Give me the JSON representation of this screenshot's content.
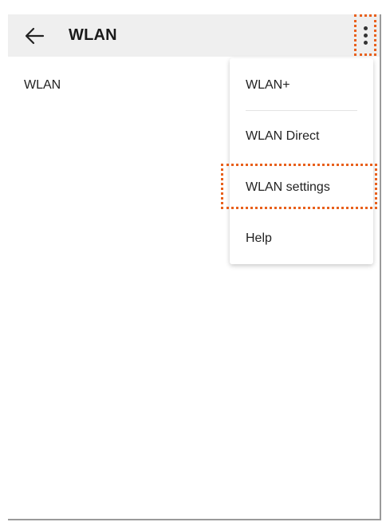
{
  "appbar": {
    "back_icon": "arrow-left-icon",
    "title": "WLAN",
    "overflow_icon": "more-vertical-icon"
  },
  "content": {
    "label": "WLAN"
  },
  "menu": {
    "items": [
      {
        "label": "WLAN+"
      },
      {
        "label": "WLAN Direct"
      },
      {
        "label": "WLAN settings"
      },
      {
        "label": "Help"
      }
    ]
  },
  "annotation": {
    "highlight_color": "#e8601c"
  }
}
